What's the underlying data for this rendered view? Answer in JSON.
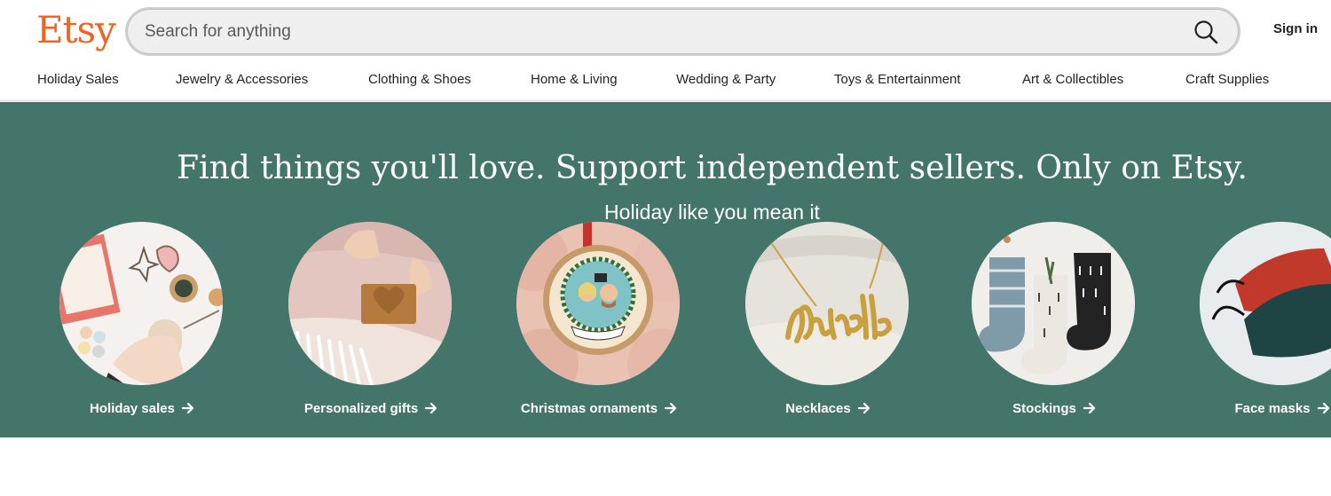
{
  "header": {
    "logo": "Etsy",
    "search_placeholder": "Search for anything",
    "search_icon": "search-icon",
    "sign_in": "Sign in"
  },
  "categories": [
    "Holiday Sales",
    "Jewelry & Accessories",
    "Clothing & Shoes",
    "Home & Living",
    "Wedding & Party",
    "Toys & Entertainment",
    "Art & Collectibles",
    "Craft Supplies"
  ],
  "hero": {
    "title": "Find things you'll love. Support independent sellers. Only on Etsy.",
    "subtitle": "Holiday like you mean it",
    "background": "#43756B",
    "items": [
      {
        "label": "Holiday sales",
        "image": "ornament-craft-kit"
      },
      {
        "label": "Personalized gifts",
        "image": "personalized-blanket"
      },
      {
        "label": "Christmas ornaments",
        "image": "wood-slice-ornament"
      },
      {
        "label": "Necklaces",
        "image": "name-necklace"
      },
      {
        "label": "Stockings",
        "image": "stockings"
      },
      {
        "label": "Face masks",
        "image": "face-masks"
      }
    ]
  },
  "colors": {
    "brand": "#F1641E",
    "hero_bg": "#43756B",
    "text": "#222222"
  }
}
